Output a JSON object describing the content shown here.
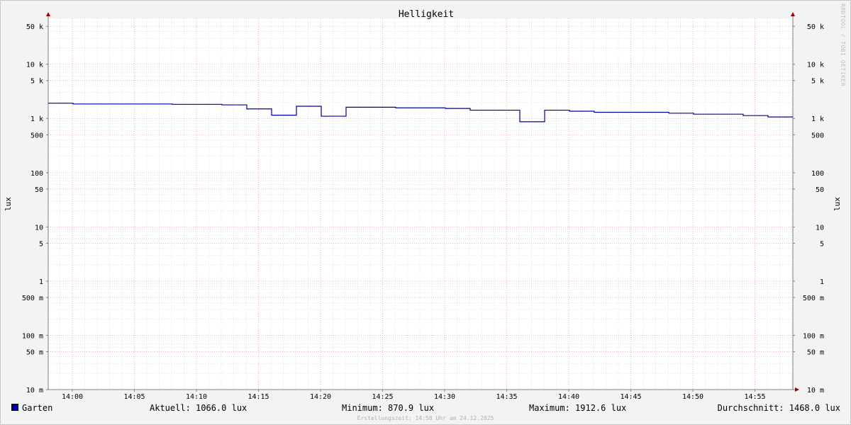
{
  "chart_data": {
    "type": "line",
    "title": "Helligkeit",
    "ylabel_left": "lux",
    "ylabel_right": "lux",
    "y_scale": "log",
    "ylim": [
      0.01,
      70000
    ],
    "x_ticks": [
      "14:00",
      "14:05",
      "14:10",
      "14:15",
      "14:20",
      "14:25",
      "14:30",
      "14:35",
      "14:40",
      "14:45",
      "14:50",
      "14:55"
    ],
    "y_ticks": [
      {
        "value": 50000,
        "label": "50 k"
      },
      {
        "value": 10000,
        "label": "10 k"
      },
      {
        "value": 5000,
        "label": "5 k"
      },
      {
        "value": 1000,
        "label": "1 k"
      },
      {
        "value": 500,
        "label": "500"
      },
      {
        "value": 100,
        "label": "100"
      },
      {
        "value": 50,
        "label": "50"
      },
      {
        "value": 10,
        "label": "10"
      },
      {
        "value": 5,
        "label": "5"
      },
      {
        "value": 1,
        "label": "1"
      },
      {
        "value": 0.5,
        "label": "500 m"
      },
      {
        "value": 0.1,
        "label": "100 m"
      },
      {
        "value": 0.05,
        "label": "50 m"
      },
      {
        "value": 0.01,
        "label": "10 m"
      }
    ],
    "series": [
      {
        "name": "Garten",
        "color": "#0000a0",
        "step_values": [
          1912.6,
          1850,
          1850,
          1850,
          1850,
          1820,
          1820,
          1780,
          1500,
          1150,
          1680,
          1100,
          1610,
          1610,
          1570,
          1570,
          1530,
          1420,
          1420,
          870.9,
          1420,
          1360,
          1300,
          1300,
          1300,
          1250,
          1200,
          1200,
          1130,
          1066
        ]
      }
    ],
    "grid": true
  },
  "legend": {
    "series_name": "Garten",
    "current": "Aktuell: 1066.0 lux",
    "minimum": "Minimum: 870.9 lux",
    "maximum": "Maximum: 1912.6 lux",
    "average": "Durchschnitt: 1468.0 lux"
  },
  "footer": "Erstellungszeit: 14:58 Uhr am 24.12.2025",
  "watermark": "RRDTOOL / TOBI OETIKER",
  "colors": {
    "line": "#0000a0",
    "major_grid": "#f0a0a0",
    "minor_grid": "#d0d0d0",
    "axis": "#808080",
    "arrow": "#a00000"
  }
}
